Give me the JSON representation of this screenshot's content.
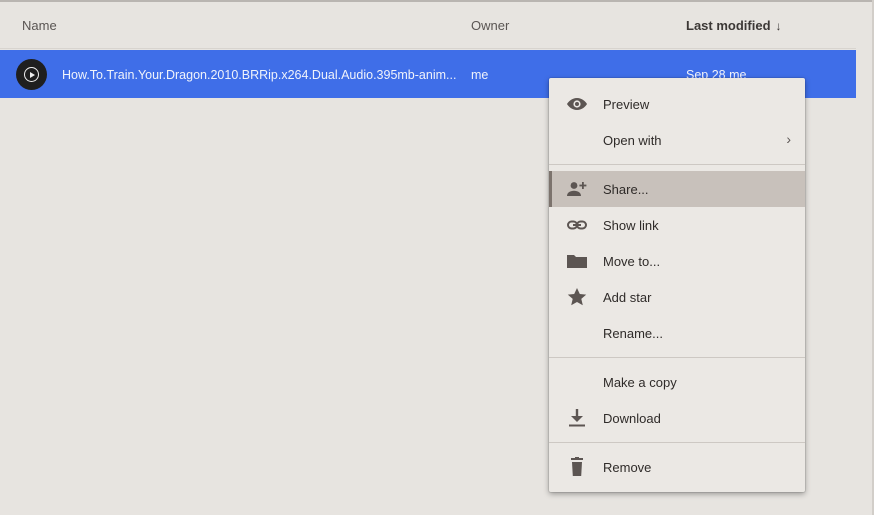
{
  "header": {
    "col_name": "Name",
    "col_owner": "Owner",
    "col_modified": "Last modified",
    "sort_arrow": "↓"
  },
  "file_row": {
    "name": "How.To.Train.Your.Dragon.2010.BRRip.x264.Dual.Audio.395mb-anim...",
    "owner": "me",
    "modified": "Sep 28  me",
    "icon": "video-file-icon",
    "selected_color": "#3f6ee8"
  },
  "context_menu": {
    "items": [
      {
        "label": "Preview",
        "icon": "eye-icon"
      },
      {
        "label": "Open with",
        "icon": "",
        "submenu_arrow": "›"
      },
      {
        "label": "Share...",
        "icon": "person-add-icon",
        "active": true
      },
      {
        "label": "Show link",
        "icon": "link-icon"
      },
      {
        "label": "Move to...",
        "icon": "folder-icon"
      },
      {
        "label": "Add star",
        "icon": "star-icon"
      },
      {
        "label": "Rename...",
        "icon": ""
      },
      {
        "label": "Make a copy",
        "icon": ""
      },
      {
        "label": "Download",
        "icon": "download-icon"
      },
      {
        "label": "Remove",
        "icon": "trash-icon"
      }
    ]
  },
  "colors": {
    "background": "#e7e4e0",
    "menu_background": "#ebe8e4",
    "menu_active": "#c8c1bb",
    "icon_color": "#5c5552"
  }
}
